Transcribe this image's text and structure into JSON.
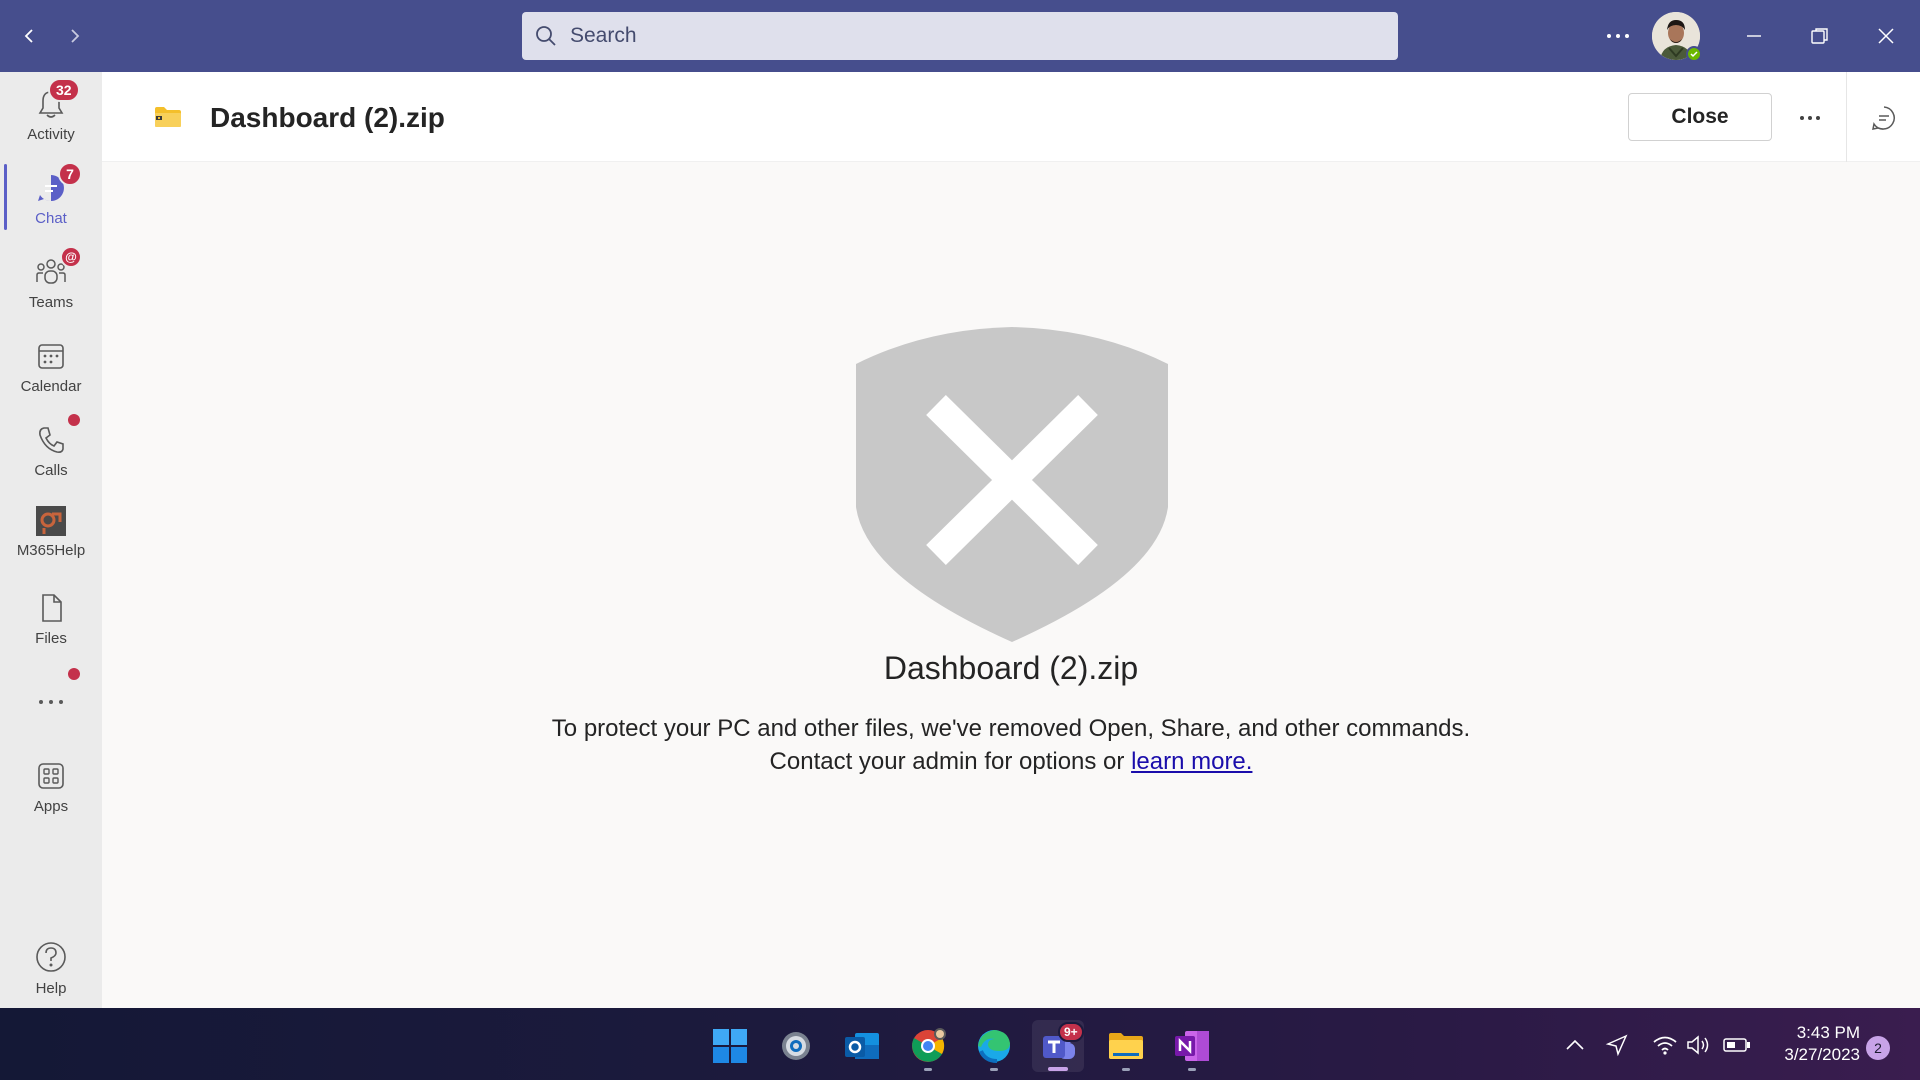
{
  "titlebar": {
    "search_placeholder": "Search"
  },
  "rail": {
    "items": [
      {
        "label": "Activity",
        "badge": "32"
      },
      {
        "label": "Chat",
        "badge": "7"
      },
      {
        "label": "Teams",
        "badge": "@"
      },
      {
        "label": "Calendar"
      },
      {
        "label": "Calls"
      },
      {
        "label": "M365Help"
      },
      {
        "label": "Files"
      },
      {
        "label": "Apps"
      },
      {
        "label": "Help"
      }
    ]
  },
  "header": {
    "file_name": "Dashboard (2).zip",
    "close_label": "Close"
  },
  "main": {
    "file_name": "Dashboard (2).zip",
    "message_line1": "To protect your PC and other files, we've removed Open, Share, and other commands.",
    "message_line2_prefix": "Contact your admin for options or ",
    "learn_more": "learn more."
  },
  "taskbar": {
    "teams_badge": "9+",
    "time": "3:43 PM",
    "date": "3/27/2023",
    "notifications": "2"
  },
  "colors": {
    "titlebar": "#464e8d",
    "accent": "#5b5fc7",
    "badge": "#c4314b",
    "shield": "#c8c8c8"
  }
}
